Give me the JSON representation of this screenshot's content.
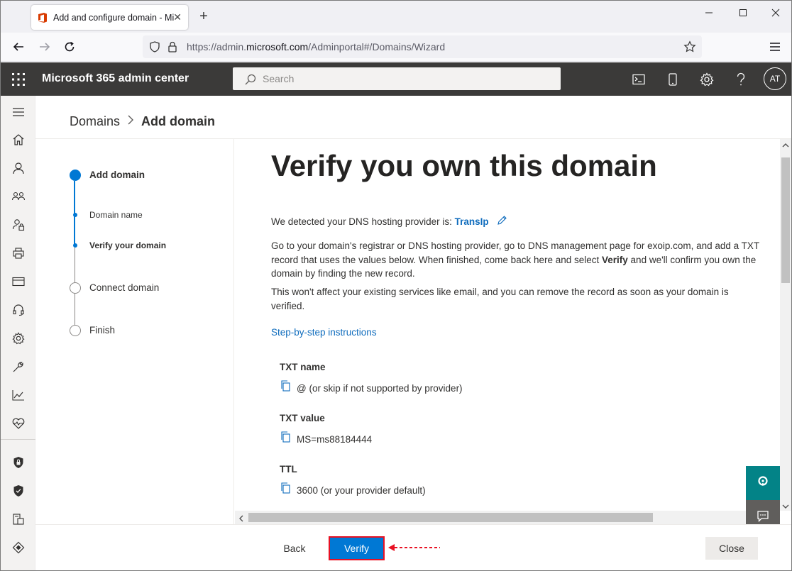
{
  "browser": {
    "tab_title": "Add and configure domain - Mic",
    "url_prefix": "https://admin.",
    "url_domain": "microsoft.com",
    "url_path": "/Adminportal#/Domains/Wizard",
    "tab_close": "✕",
    "new_tab": "+"
  },
  "header": {
    "app_title": "Microsoft 365 admin center",
    "search_placeholder": "Search",
    "avatar_initials": "AT"
  },
  "breadcrumb": {
    "root": "Domains",
    "separator": "›",
    "current": "Add domain"
  },
  "wizard": {
    "steps": [
      {
        "label": "Add domain",
        "state": "active"
      },
      {
        "label": "Domain name",
        "state": "sub-done"
      },
      {
        "label": "Verify your domain",
        "state": "sub-current"
      },
      {
        "label": "Connect domain",
        "state": "pending"
      },
      {
        "label": "Finish",
        "state": "pending"
      }
    ]
  },
  "content": {
    "title": "Verify you own this domain",
    "detected_prefix": "We detected your DNS hosting provider is: ",
    "dns_provider": "TransIp",
    "instructions_p1_a": "Go to your domain's registrar or DNS hosting provider, go to DNS management page for exoip.com, and add a TXT record that uses the values below. When finished, come back here and select ",
    "instructions_p1_bold": "Verify",
    "instructions_p1_b": " and we'll confirm you own the domain by finding the new record.",
    "instructions_p2": "This won't affect your existing services like email, and you can remove the record as soon as your domain is verified.",
    "step_link": "Step-by-step instructions",
    "txt_name_label": "TXT name",
    "txt_name_value": "@ (or skip if not supported by provider)",
    "txt_value_label": "TXT value",
    "txt_value_value": "MS=ms88184444",
    "ttl_label": "TTL",
    "ttl_value": "3600 (or your provider default)"
  },
  "footer": {
    "back_label": "Back",
    "verify_label": "Verify",
    "close_label": "Close"
  },
  "colors": {
    "accent": "#0078d4",
    "header_bg": "#3b3a39",
    "link": "#0f6cbd",
    "highlight_red": "#e81123",
    "help_teal": "#038387"
  }
}
